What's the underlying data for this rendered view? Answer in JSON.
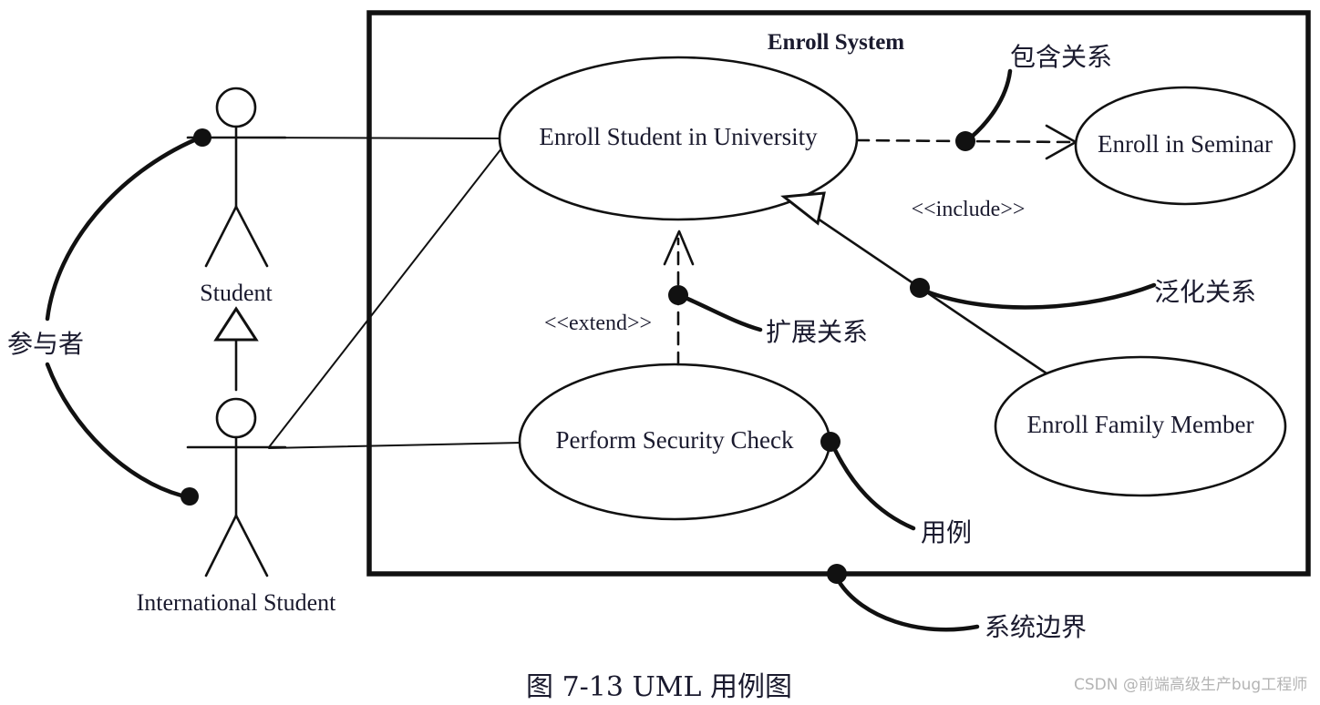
{
  "diagram": {
    "title_caption": "图 7-13   UML 用例图",
    "system_boundary_label": "Enroll System",
    "watermark": "CSDN @前端高级生产bug工程师",
    "actors": [
      {
        "id": "student",
        "label": "Student"
      },
      {
        "id": "international-student",
        "label": "International Student"
      }
    ],
    "use_cases": [
      {
        "id": "enroll-student-in-university",
        "label": "Enroll Student in University"
      },
      {
        "id": "enroll-in-seminar",
        "label": "Enroll in Seminar"
      },
      {
        "id": "enroll-family-member",
        "label": "Enroll Family Member"
      },
      {
        "id": "perform-security-check",
        "label": "Perform Security Check"
      }
    ],
    "stereotypes": [
      {
        "id": "include",
        "label": "<<include>>"
      },
      {
        "id": "extend",
        "label": "<<extend>>"
      }
    ],
    "annotations": [
      {
        "id": "actor-annotation",
        "label": "参与者"
      },
      {
        "id": "include-annotation",
        "label": "包含关系"
      },
      {
        "id": "generalization-annotation",
        "label": "泛化关系"
      },
      {
        "id": "extend-annotation",
        "label": "扩展关系"
      },
      {
        "id": "usecase-annotation",
        "label": "用例"
      },
      {
        "id": "system-boundary-annotation",
        "label": "系统边界"
      }
    ],
    "colors": {
      "stroke": "#111111",
      "text": "#1a1a2e",
      "background": "#ffffff",
      "watermark": "#b4b4b4"
    }
  }
}
